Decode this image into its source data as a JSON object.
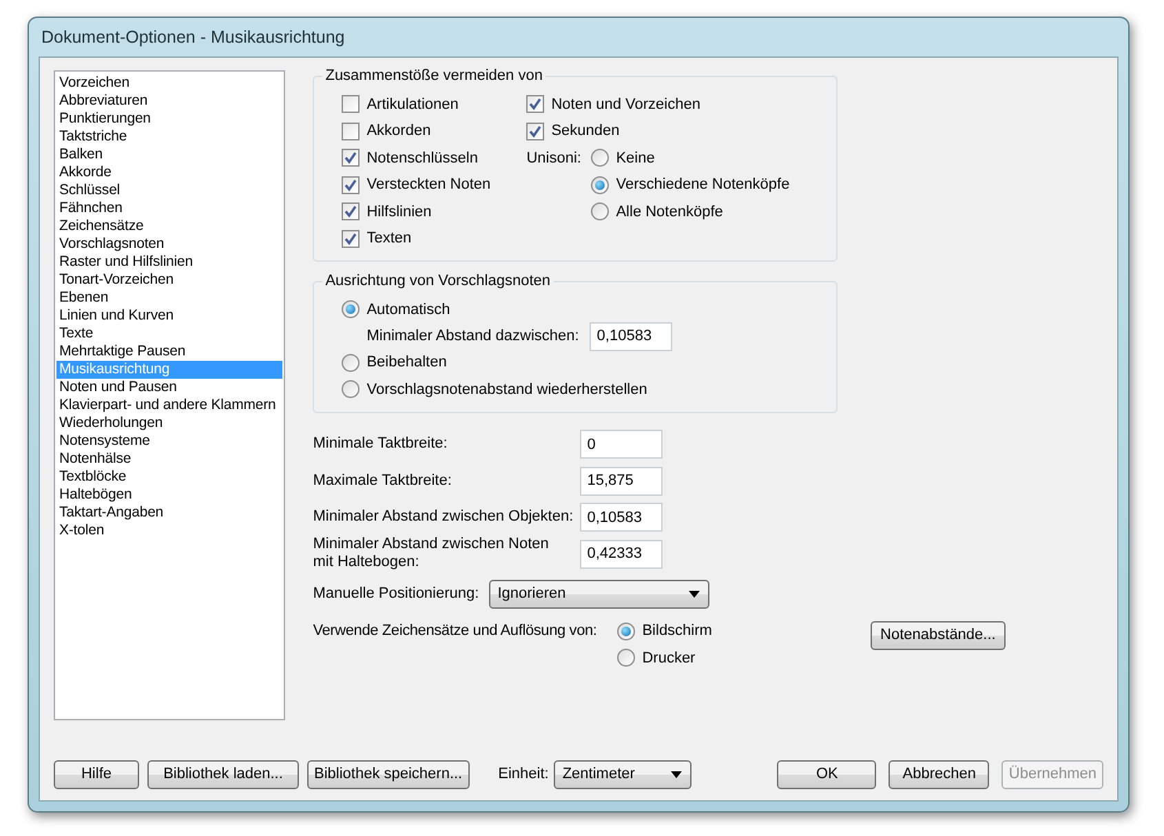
{
  "window": {
    "title": "Dokument-Optionen - Musikausrichtung"
  },
  "sidebar": {
    "items": [
      {
        "label": "Vorzeichen",
        "selected": false
      },
      {
        "label": "Abbreviaturen",
        "selected": false
      },
      {
        "label": "Punktierungen",
        "selected": false
      },
      {
        "label": "Taktstriche",
        "selected": false
      },
      {
        "label": "Balken",
        "selected": false
      },
      {
        "label": "Akkorde",
        "selected": false
      },
      {
        "label": "Schlüssel",
        "selected": false
      },
      {
        "label": "Fähnchen",
        "selected": false
      },
      {
        "label": "Zeichensätze",
        "selected": false
      },
      {
        "label": "Vorschlagsnoten",
        "selected": false
      },
      {
        "label": "Raster und Hilfslinien",
        "selected": false
      },
      {
        "label": "Tonart-Vorzeichen",
        "selected": false
      },
      {
        "label": "Ebenen",
        "selected": false
      },
      {
        "label": "Linien und Kurven",
        "selected": false
      },
      {
        "label": "Texte",
        "selected": false
      },
      {
        "label": "Mehrtaktige Pausen",
        "selected": false
      },
      {
        "label": "Musikausrichtung",
        "selected": true
      },
      {
        "label": "Noten und Pausen",
        "selected": false
      },
      {
        "label": "Klavierpart- und andere Klammern",
        "selected": false
      },
      {
        "label": "Wiederholungen",
        "selected": false
      },
      {
        "label": "Notensysteme",
        "selected": false
      },
      {
        "label": "Notenhälse",
        "selected": false
      },
      {
        "label": "Textblöcke",
        "selected": false
      },
      {
        "label": "Haltebögen",
        "selected": false
      },
      {
        "label": "Taktart-Angaben",
        "selected": false
      },
      {
        "label": "X-tolen",
        "selected": false
      }
    ]
  },
  "collisions": {
    "title": "Zusammenstöße vermeiden von",
    "left_checkboxes": [
      {
        "label": "Artikulationen",
        "checked": false
      },
      {
        "label": "Akkorden",
        "checked": false
      },
      {
        "label": "Notenschlüsseln",
        "checked": true
      },
      {
        "label": "Versteckten Noten",
        "checked": true
      },
      {
        "label": "Hilfslinien",
        "checked": true
      },
      {
        "label": "Texten",
        "checked": true
      }
    ],
    "right_checkboxes": [
      {
        "label": "Noten und Vorzeichen",
        "checked": true
      },
      {
        "label": "Sekunden",
        "checked": true
      }
    ],
    "unison": {
      "label": "Unisoni:",
      "options": [
        {
          "label": "Keine",
          "selected": false
        },
        {
          "label": "Verschiedene Notenköpfe",
          "selected": true
        },
        {
          "label": "Alle Notenköpfe",
          "selected": false
        }
      ]
    }
  },
  "grace_notes": {
    "title": "Ausrichtung von Vorschlagsnoten",
    "options": [
      {
        "label": "Automatisch",
        "selected": true
      },
      {
        "label": "Beibehalten",
        "selected": false
      },
      {
        "label": "Vorschlagsnotenabstand wiederherstellen",
        "selected": false
      }
    ],
    "min_distance": {
      "label": "Minimaler Abstand dazwischen:",
      "value": "0,10583"
    }
  },
  "measure_fields": [
    {
      "label": "Minimale Taktbreite:",
      "value": "0"
    },
    {
      "label": "Maximale Taktbreite:",
      "value": "15,875"
    },
    {
      "label": "Minimaler Abstand zwischen Objekten:",
      "value": "0,10583"
    },
    {
      "label": "Minimaler Abstand zwischen Noten\nmit Haltebogen:",
      "value": "0,42333"
    }
  ],
  "positioning": {
    "label": "Manuelle Positionierung:",
    "value": "Ignorieren"
  },
  "font_source": {
    "label": "Verwende Zeichensätze und Auflösung von:",
    "options": [
      {
        "label": "Bildschirm",
        "selected": true
      },
      {
        "label": "Drucker",
        "selected": false
      }
    ]
  },
  "spacing_button": {
    "label": "Notenabstände..."
  },
  "footer": {
    "left_buttons": [
      {
        "label": "Hilfe",
        "disabled": false
      },
      {
        "label": "Bibliothek laden...",
        "disabled": false
      },
      {
        "label": "Bibliothek speichern...",
        "disabled": false
      }
    ],
    "unit": {
      "label": "Einheit:",
      "value": "Zentimeter"
    },
    "right_buttons": [
      {
        "label": "OK",
        "disabled": false
      },
      {
        "label": "Abbrechen",
        "disabled": false
      },
      {
        "label": "Übernehmen",
        "disabled": true
      }
    ]
  }
}
